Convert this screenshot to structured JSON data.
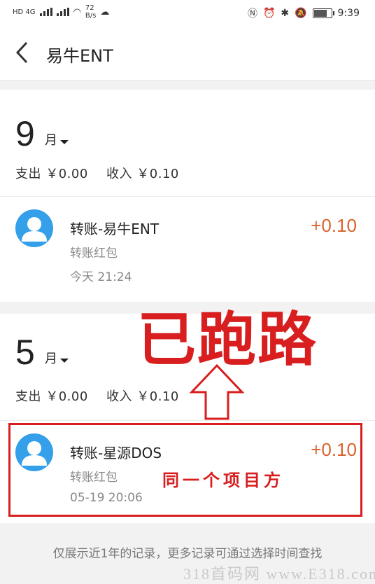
{
  "status_bar": {
    "network_left": "HD 4G",
    "speed_value": "72",
    "speed_unit": "B/s",
    "time": "9:39"
  },
  "nav": {
    "title": "易牛ENT"
  },
  "sections": [
    {
      "month_number": "9",
      "month_unit": "月",
      "expense": "支出 ￥0.00",
      "income": "收入 ￥0.10",
      "transaction": {
        "title": "转账-易牛ENT",
        "subtitle": "转账红包",
        "time": "今天   21:24",
        "amount": "+0.10"
      }
    },
    {
      "month_number": "5",
      "month_unit": "月",
      "expense": "支出 ￥0.00",
      "income": "收入 ￥0.10",
      "transaction": {
        "title": "转账-星源DOS",
        "subtitle": "转账红包",
        "time": "05-19   20:06",
        "amount": "+0.10"
      }
    }
  ],
  "footer": {
    "text": "仅展示近1年的记录，更多记录可通过选择时间查找"
  },
  "annotations": {
    "stamp_text": "已跑路",
    "note_text": "同一个项目方",
    "watermark": "318首码网 www.E318.com"
  },
  "colors": {
    "amount": "#d9632b",
    "annotation_red": "#d81e1e",
    "avatar_blue": "#35a0ea"
  }
}
